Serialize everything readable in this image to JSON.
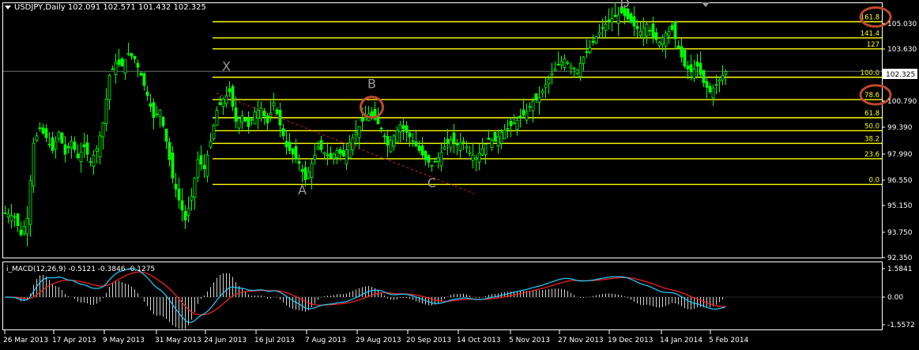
{
  "window": {
    "symbol_line": "USDJPY,Daily  102.091 102.571 101.432 102.325",
    "macd_line": "i_MACD(12,26,9) -0.5121 -0.3846 -0.1275"
  },
  "colors": {
    "background": "#000000",
    "candles": "#00ff00",
    "fib_lines": "#ffff00",
    "fib_labels": "#ffff00",
    "wave_labels": "#9a9a9a",
    "circles": "#c0482a",
    "trendline": "#cc2222",
    "macd_signal": "#ff2020",
    "macd_main": "#20d0ff",
    "histogram": "#d0d0d0",
    "axis_text": "#ffffff",
    "price_line": "#707070"
  },
  "price_axis": {
    "ticks": [
      "105.030",
      "103.630",
      "102.325",
      "100.790",
      "99.390",
      "97.990",
      "96.550",
      "95.150",
      "93.750",
      "92.350"
    ],
    "current_price": "102.325"
  },
  "macd_axis": {
    "ticks": [
      "1.5841",
      "0.00",
      "-1.5572"
    ]
  },
  "time_axis": {
    "ticks": [
      "26 Mar 2013",
      "17 Apr 2013",
      "9 May 2013",
      "31 May 2013",
      "24 Jun 2013",
      "16 Jul 2013",
      "7 Aug 2013",
      "29 Aug 2013",
      "20 Sep 2013",
      "14 Oct 2013",
      "5 Nov 2013",
      "27 Nov 2013",
      "19 Dec 2013",
      "14 Jan 2014",
      "5 Feb 2014"
    ]
  },
  "fibonacci": {
    "levels": [
      {
        "label": "161.8",
        "price": 105.03,
        "circled": true
      },
      {
        "label": "141.4",
        "price": 104.15,
        "circled": false
      },
      {
        "label": "127",
        "price": 103.55,
        "circled": false
      },
      {
        "label": "100.0",
        "price": 102.0,
        "circled": false
      },
      {
        "label": "78.6",
        "price": 100.78,
        "circled": true
      },
      {
        "label": "61.8",
        "price": 99.79,
        "circled": false
      },
      {
        "label": "50.0",
        "price": 99.08,
        "circled": false
      },
      {
        "label": "38.2",
        "price": 98.39,
        "circled": false
      },
      {
        "label": "23.6",
        "price": 97.55,
        "circled": false
      },
      {
        "label": "0.0",
        "price": 96.15,
        "circled": false
      }
    ]
  },
  "waves": [
    {
      "label": "X",
      "date_index": 70,
      "price": 102.35
    },
    {
      "label": "B",
      "date_index": 116,
      "price": 101.4
    },
    {
      "label": "A",
      "date_index": 94,
      "price": 95.6
    },
    {
      "label": "C",
      "date_index": 135,
      "price": 96.0
    },
    {
      "label": "D",
      "date_index": 196,
      "price": 105.8
    }
  ],
  "chart_data": {
    "type": "candlestick",
    "title": "USDJPY,Daily",
    "ohlc_header": {
      "open": 102.091,
      "high": 102.571,
      "low": 101.432,
      "close": 102.325
    },
    "ylim": [
      92.2,
      106.0
    ],
    "x_ticks": [
      "26 Mar 2013",
      "17 Apr 2013",
      "9 May 2013",
      "31 May 2013",
      "24 Jun 2013",
      "16 Jul 2013",
      "7 Aug 2013",
      "29 Aug 2013",
      "20 Sep 2013",
      "14 Oct 2013",
      "5 Nov 2013",
      "27 Nov 2013",
      "19 Dec 2013",
      "14 Jan 2014",
      "5 Feb 2014"
    ],
    "close_path": [
      [
        0,
        94.6
      ],
      [
        3,
        94.4
      ],
      [
        5,
        93.4
      ],
      [
        7,
        94.3
      ],
      [
        9,
        98.4
      ],
      [
        11,
        99.2
      ],
      [
        13,
        98.7
      ],
      [
        15,
        98.0
      ],
      [
        17,
        99.0
      ],
      [
        19,
        97.8
      ],
      [
        21,
        98.5
      ],
      [
        23,
        97.6
      ],
      [
        25,
        98.2
      ],
      [
        27,
        97.4
      ],
      [
        29,
        98.1
      ],
      [
        31,
        99.5
      ],
      [
        33,
        102.1
      ],
      [
        35,
        102.8
      ],
      [
        37,
        102.6
      ],
      [
        39,
        103.3
      ],
      [
        41,
        103.0
      ],
      [
        43,
        102.1
      ],
      [
        45,
        101.0
      ],
      [
        47,
        99.8
      ],
      [
        49,
        100.2
      ],
      [
        51,
        98.5
      ],
      [
        53,
        96.5
      ],
      [
        55,
        95.3
      ],
      [
        57,
        94.2
      ],
      [
        59,
        95.5
      ],
      [
        61,
        97.5
      ],
      [
        63,
        97.0
      ],
      [
        65,
        98.5
      ],
      [
        67,
        100.2
      ],
      [
        69,
        100.8
      ],
      [
        71,
        101.2
      ],
      [
        73,
        99.6
      ],
      [
        75,
        99.9
      ],
      [
        77,
        99.3
      ],
      [
        79,
        100.1
      ],
      [
        81,
        100.3
      ],
      [
        83,
        99.5
      ],
      [
        85,
        100.6
      ],
      [
        87,
        99.4
      ],
      [
        89,
        98.2
      ],
      [
        91,
        97.8
      ],
      [
        93,
        97.3
      ],
      [
        95,
        96.4
      ],
      [
        97,
        97.3
      ],
      [
        99,
        98.2
      ],
      [
        101,
        97.9
      ],
      [
        103,
        97.6
      ],
      [
        105,
        98.0
      ],
      [
        107,
        97.7
      ],
      [
        109,
        98.4
      ],
      [
        111,
        99.0
      ],
      [
        113,
        99.6
      ],
      [
        115,
        100.0
      ],
      [
        117,
        99.7
      ],
      [
        119,
        99.2
      ],
      [
        121,
        98.3
      ],
      [
        123,
        98.8
      ],
      [
        125,
        99.4
      ],
      [
        127,
        99.0
      ],
      [
        129,
        98.5
      ],
      [
        131,
        98.0
      ],
      [
        133,
        97.5
      ],
      [
        135,
        97.2
      ],
      [
        137,
        97.6
      ],
      [
        139,
        98.2
      ],
      [
        141,
        98.6
      ],
      [
        143,
        98.3
      ],
      [
        145,
        98.5
      ],
      [
        147,
        97.9
      ],
      [
        149,
        97.6
      ],
      [
        151,
        98.1
      ],
      [
        153,
        98.6
      ],
      [
        155,
        98.5
      ],
      [
        157,
        99.0
      ],
      [
        159,
        99.2
      ],
      [
        161,
        99.5
      ],
      [
        163,
        99.8
      ],
      [
        165,
        100.1
      ],
      [
        167,
        100.7
      ],
      [
        169,
        100.9
      ],
      [
        171,
        101.6
      ],
      [
        173,
        102.2
      ],
      [
        175,
        102.7
      ],
      [
        177,
        103.0
      ],
      [
        179,
        102.6
      ],
      [
        181,
        102.4
      ],
      [
        183,
        103.1
      ],
      [
        185,
        103.6
      ],
      [
        187,
        104.2
      ],
      [
        189,
        104.7
      ],
      [
        191,
        105.1
      ],
      [
        193,
        105.3
      ],
      [
        195,
        105.5
      ],
      [
        197,
        105.2
      ],
      [
        199,
        104.8
      ],
      [
        201,
        104.5
      ],
      [
        203,
        104.9
      ],
      [
        205,
        104.2
      ],
      [
        207,
        103.9
      ],
      [
        209,
        104.4
      ],
      [
        211,
        104.6
      ],
      [
        213,
        103.6
      ],
      [
        215,
        102.6
      ],
      [
        217,
        102.3
      ],
      [
        219,
        102.6
      ],
      [
        221,
        101.7
      ],
      [
        223,
        101.2
      ],
      [
        225,
        101.6
      ],
      [
        227,
        102.1
      ],
      [
        228,
        102.3
      ]
    ]
  }
}
